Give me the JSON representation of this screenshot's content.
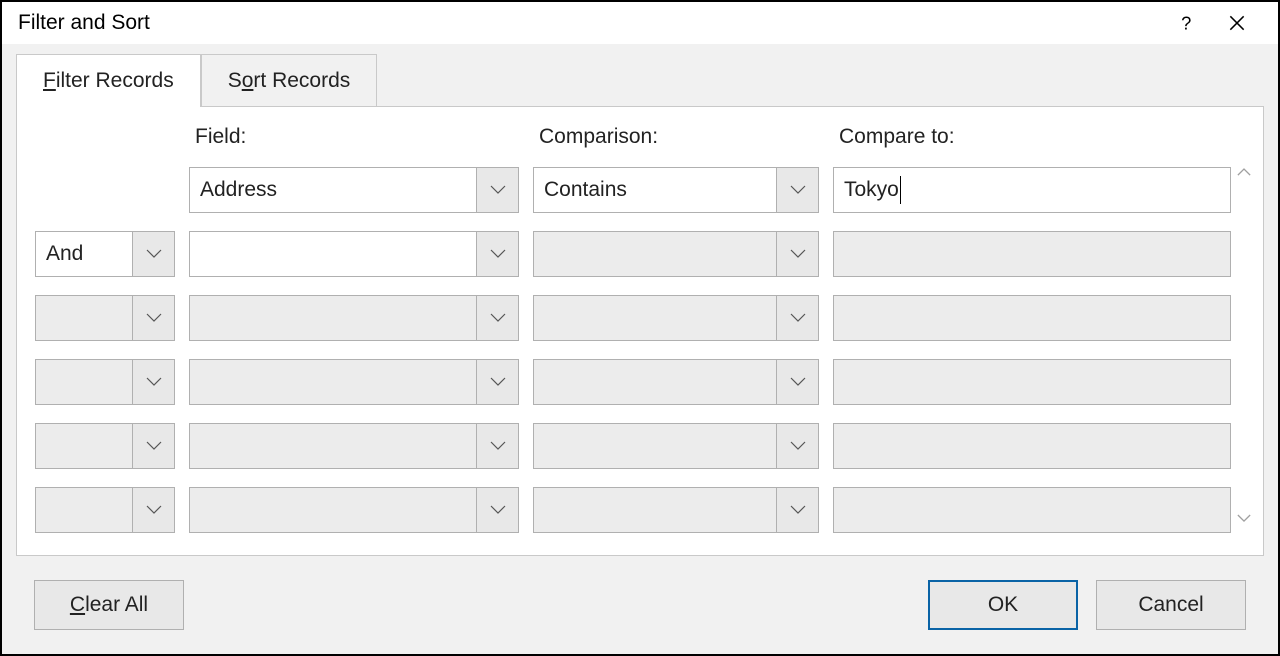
{
  "title": "Filter and Sort",
  "tabs": {
    "filter_pre": "F",
    "filter_post": "ilter Records",
    "sort_pre": "S",
    "sort_mid": "o",
    "sort_post": "rt Records"
  },
  "headers": {
    "field": "Field:",
    "comparison": "Comparison:",
    "compare_to": "Compare to:"
  },
  "rows": [
    {
      "logic": "",
      "field": "Address",
      "comparison": "Contains",
      "compare_to": "Tokyo",
      "enabled": true,
      "logic_enabled": false
    },
    {
      "logic": "And",
      "field": "",
      "comparison": "",
      "compare_to": "",
      "enabled": true,
      "logic_enabled": true
    },
    {
      "logic": "",
      "field": "",
      "comparison": "",
      "compare_to": "",
      "enabled": false,
      "logic_enabled": false
    },
    {
      "logic": "",
      "field": "",
      "comparison": "",
      "compare_to": "",
      "enabled": false,
      "logic_enabled": false
    },
    {
      "logic": "",
      "field": "",
      "comparison": "",
      "compare_to": "",
      "enabled": false,
      "logic_enabled": false
    },
    {
      "logic": "",
      "field": "",
      "comparison": "",
      "compare_to": "",
      "enabled": false,
      "logic_enabled": false
    }
  ],
  "buttons": {
    "clear_pre": "C",
    "clear_post": "lear All",
    "ok": "OK",
    "cancel": "Cancel"
  }
}
